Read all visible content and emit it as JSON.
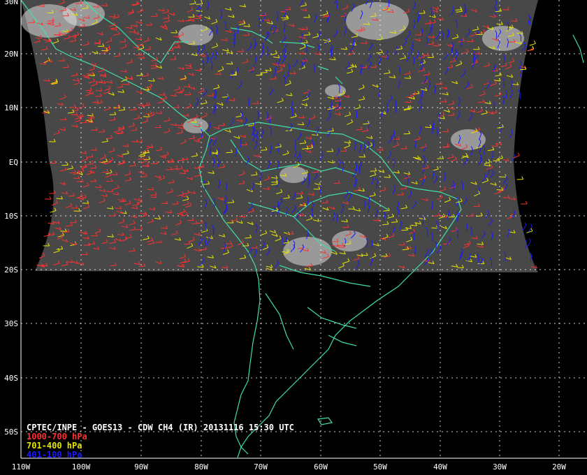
{
  "title": "CPTEC/INPE - GOES13 - CDW CH4 (IR) 20131116 15:30 UTC",
  "legend": [
    {
      "label": "1000-700 hPa",
      "color": "#ff3030"
    },
    {
      "label": "701-400 hPa",
      "color": "#e6e600"
    },
    {
      "label": "401-100 hPa",
      "color": "#1a1aff"
    }
  ],
  "lat_labels": [
    "30N",
    "20N",
    "10N",
    "EQ",
    "10S",
    "20S",
    "30S",
    "40S",
    "50S"
  ],
  "lon_labels": [
    "110W",
    "100W",
    "90W",
    "80W",
    "70W",
    "60W",
    "50W",
    "40W",
    "30W",
    "20W"
  ],
  "colors": {
    "background": "#000000",
    "coastline": "#3ee0a8",
    "grid": "#ffffff",
    "satellite": "#4a4a4a",
    "cloud": "#e8e8e8"
  }
}
